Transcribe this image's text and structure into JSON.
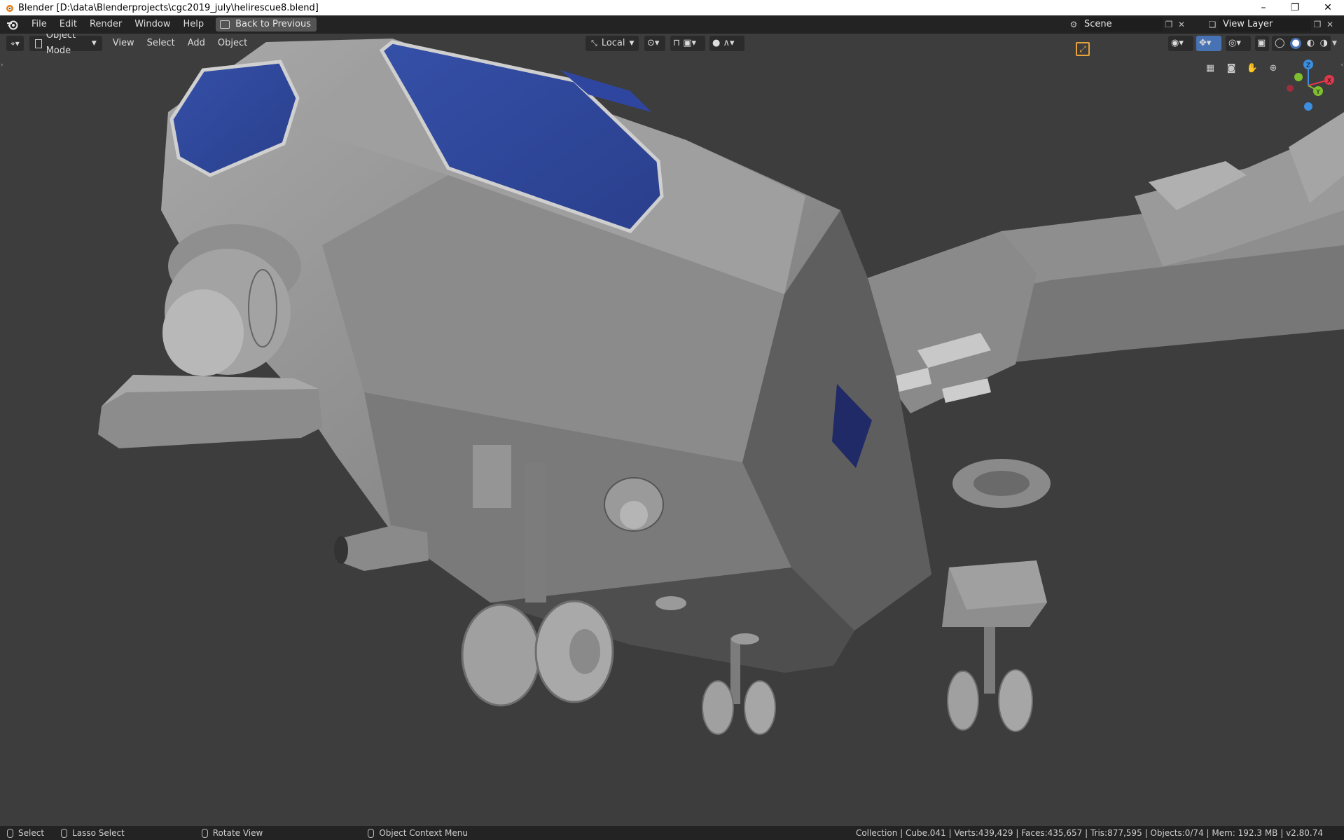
{
  "window": {
    "title": "Blender [D:\\data\\Blenderprojects\\cgc2019_july\\helirescue8.blend]",
    "controls": {
      "minimize": "–",
      "restore": "❐",
      "close": "✕"
    }
  },
  "menubar": {
    "items": [
      "File",
      "Edit",
      "Render",
      "Window",
      "Help"
    ],
    "back_button": "Back to Previous",
    "scene_label": "Scene",
    "view_layer_label": "View Layer"
  },
  "viewport_header": {
    "mode": "Object Mode",
    "menus": [
      "View",
      "Select",
      "Add",
      "Object"
    ],
    "transform_orientation": "Local",
    "shading_active": "solid"
  },
  "colors": {
    "accent_blue": "#4772b3",
    "active_orange": "#e8a33d",
    "axis_x": "#e0374b",
    "axis_y": "#7fbf2f",
    "axis_z": "#3c8ee0"
  },
  "gizmo": {
    "x_label": "X",
    "y_label": "Y",
    "z_label": "Z"
  },
  "statusbar": {
    "select": "Select",
    "lasso": "Lasso Select",
    "rotate": "Rotate View",
    "context_menu": "Object Context Menu",
    "info": "Collection | Cube.041 | Verts:439,429 | Faces:435,657 | Tris:877,595 | Objects:0/74 | Mem: 192.3 MB | v2.80.74"
  }
}
